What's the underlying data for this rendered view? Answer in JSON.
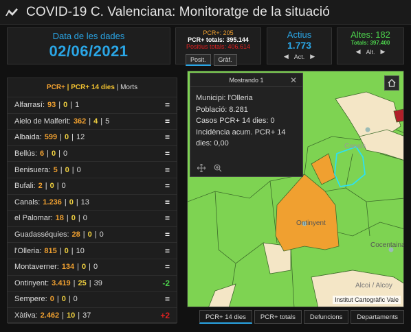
{
  "app": {
    "title": "COVID-19 C. Valenciana: Monitoratge de la situació"
  },
  "date_panel": {
    "label": "Data de les dades",
    "value": "02/06/2021"
  },
  "pcr_panel": {
    "line1": "PCR+: 205",
    "line2": "PCR+ totals: 395.144",
    "line3": "Positius totals: 406.614",
    "tabs": [
      "Posit.",
      "Gràf."
    ]
  },
  "actius_panel": {
    "label": "Actius",
    "value": "1.773",
    "nav_label": "Act."
  },
  "altes_panel": {
    "label": "Altes: 182",
    "total": "Totals: 397.400",
    "nav_label": "Alt."
  },
  "list": {
    "header": {
      "pcr": "PCR+",
      "pcr14": "PCR+ 14 dies",
      "morts": "Morts",
      "sep": "|"
    },
    "rows": [
      {
        "name": "Alfarrasí:",
        "pcr": "93",
        "pcr14": "0",
        "morts": "1",
        "trend": "="
      },
      {
        "name": "Aielo de Malferit:",
        "pcr": "362",
        "pcr14": "4",
        "morts": "5",
        "trend": "="
      },
      {
        "name": "Albaida:",
        "pcr": "599",
        "pcr14": "0",
        "morts": "12",
        "trend": "="
      },
      {
        "name": "Bellús:",
        "pcr": "6",
        "pcr14": "0",
        "morts": "0",
        "trend": "="
      },
      {
        "name": "Benisuera:",
        "pcr": "5",
        "pcr14": "0",
        "morts": "0",
        "trend": "="
      },
      {
        "name": "Bufali:",
        "pcr": "2",
        "pcr14": "0",
        "morts": "0",
        "trend": "="
      },
      {
        "name": "Canals:",
        "pcr": "1.236",
        "pcr14": "0",
        "morts": "13",
        "trend": "="
      },
      {
        "name": "el Palomar:",
        "pcr": "18",
        "pcr14": "0",
        "morts": "0",
        "trend": "="
      },
      {
        "name": "Guadasséquies:",
        "pcr": "28",
        "pcr14": "0",
        "morts": "0",
        "trend": "="
      },
      {
        "name": "l'Olleria:",
        "pcr": "815",
        "pcr14": "0",
        "morts": "10",
        "trend": "="
      },
      {
        "name": "Montaverner:",
        "pcr": "134",
        "pcr14": "0",
        "morts": "0",
        "trend": "="
      },
      {
        "name": "Ontinyent:",
        "pcr": "3.419",
        "pcr14": "25",
        "morts": "39",
        "trend": "-2"
      },
      {
        "name": "Sempere:",
        "pcr": "0",
        "pcr14": "0",
        "morts": "0",
        "trend": "="
      },
      {
        "name": "Xàtiva:",
        "pcr": "2.462",
        "pcr14": "10",
        "morts": "37",
        "trend": "+2"
      }
    ]
  },
  "map": {
    "labels": [
      "Canals",
      "Ontinyent",
      "Cocentaina",
      "Alcoi / Alcoy"
    ],
    "attribution": "Institut Cartogràfic Vale"
  },
  "popup": {
    "title": "Mostrando 1",
    "line1": "Municipi: l'Olleria",
    "line2": "Població: 8.281",
    "line3": "Casos PCR+ 14 dies: 0",
    "line4": "Incidència acum. PCR+ 14",
    "line5": "dies: 0,00"
  },
  "bottom_tabs": [
    "PCR+ 14 dies",
    "PCR+ totals",
    "Defuncions",
    "Departaments"
  ],
  "colors": {
    "accent_blue": "#2aa6e6",
    "green": "#4cd14c",
    "orange": "#f0a030",
    "red": "#e02020"
  }
}
